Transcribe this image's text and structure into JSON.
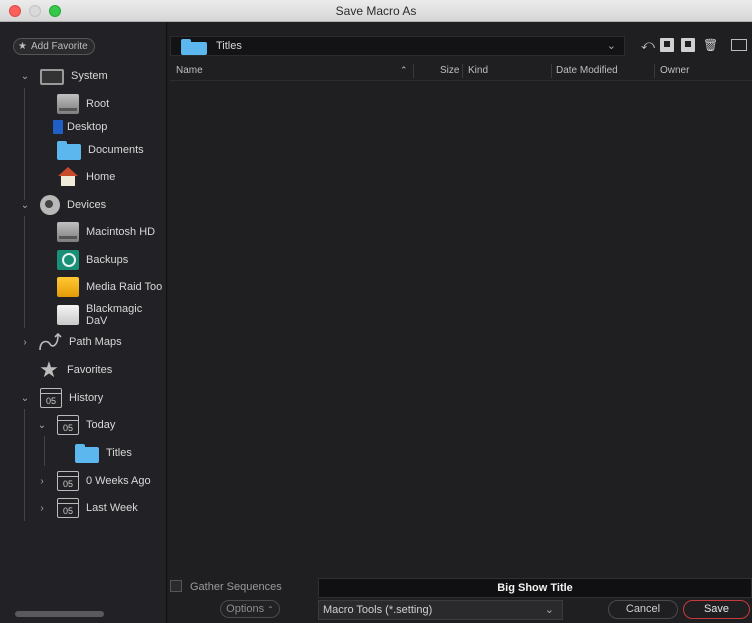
{
  "window": {
    "title": "Save Macro As"
  },
  "sidebar": {
    "add_favorite": "Add Favorite",
    "system": {
      "label": "System",
      "children": [
        "Root",
        "Desktop",
        "Documents",
        "Home"
      ]
    },
    "devices": {
      "label": "Devices",
      "children": [
        "Macintosh HD",
        "Backups",
        "Media Raid Too",
        "Blackmagic DaV"
      ]
    },
    "path_maps": "Path Maps",
    "favorites": "Favorites",
    "history": {
      "label": "History",
      "calendar_day": "05",
      "today": "Today",
      "today_child": "Titles",
      "weeks_ago": "0 Weeks Ago",
      "last_week": "Last Week"
    }
  },
  "pathbar": {
    "current_folder": "Titles"
  },
  "columns": {
    "name": "Name",
    "size": "Size",
    "kind": "Kind",
    "date_modified": "Date Modified",
    "owner": "Owner"
  },
  "footer": {
    "gather_sequences": "Gather Sequences",
    "filename_value": "Big Show Title",
    "options": "Options",
    "filter_value": "Macro Tools (*.setting)",
    "cancel": "Cancel",
    "save": "Save"
  },
  "colors": {
    "accent_save": "#c6393c",
    "folder": "#5cb7ef"
  }
}
